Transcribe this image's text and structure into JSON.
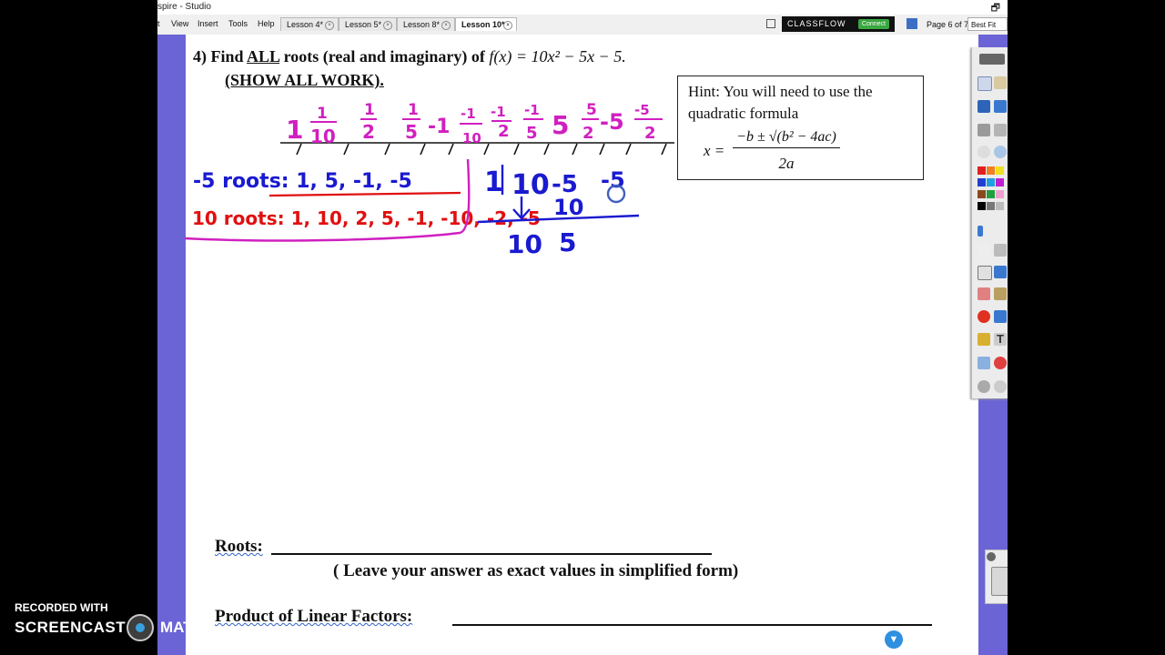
{
  "window": {
    "title": "spire - Studio",
    "restore_glyph": "🗗"
  },
  "menu": [
    "t",
    "View",
    "Insert",
    "Tools",
    "Help"
  ],
  "tabs": [
    {
      "label": "Lesson 4*",
      "active": false
    },
    {
      "label": "Lesson 5*",
      "active": false
    },
    {
      "label": "Lesson 8*",
      "active": false
    },
    {
      "label": "Lesson 10*",
      "active": true
    }
  ],
  "toolbar": {
    "classflow": "CLASSFLOW",
    "connect": "Connect",
    "page_info": "Page 6 of 7",
    "zoom": "Best Fit"
  },
  "question": {
    "number": "4)",
    "text_before": "Find",
    "all": "ALL",
    "text_after": "roots (real and imaginary) of",
    "function": "f(x) = 10x² − 5x − 5.",
    "show_work": "(SHOW ALL WORK)."
  },
  "hint": {
    "line1": "Hint: You will need to use the",
    "line2": "quadratic formula",
    "formula_lhs": "x =",
    "numerator": "−b ± √(b² − 4ac)",
    "denominator": "2a"
  },
  "answers": {
    "roots_label": "Roots:",
    "note": "( Leave your answer as exact values in simplified form)",
    "plf_label": "Product of Linear Factors:"
  },
  "handwriting": {
    "candidates_row": [
      "1",
      "1/10",
      "1/2",
      "1/5",
      "-1",
      "-1/10",
      "-1/2",
      "-1/5",
      "5",
      "5/2",
      "-5",
      "-5/2"
    ],
    "neg5_roots": "-5 roots: 1, 5, -1, -5",
    "ten_roots": "10 roots: 1, 10, 2, 5, -1, -10, -2, -5",
    "synthetic": {
      "divisor": "1",
      "coeffs": [
        "10",
        "-5",
        "-5"
      ],
      "carry": "10",
      "result": [
        "10",
        "5"
      ]
    }
  },
  "colors": {
    "blue_ink": "#1a1ad0",
    "red_ink": "#e01010",
    "magenta_ink": "#d020c0",
    "purple_band": "#6b64d6"
  },
  "screencast": {
    "line1": "RECORDED WITH",
    "line2": "SCREENCAST",
    "line3": "MATIC"
  },
  "icons": [
    "page-icon",
    "next-page-icon",
    "trash-icon",
    "pen-icon",
    "eraser-icon",
    "pointer-icon"
  ]
}
